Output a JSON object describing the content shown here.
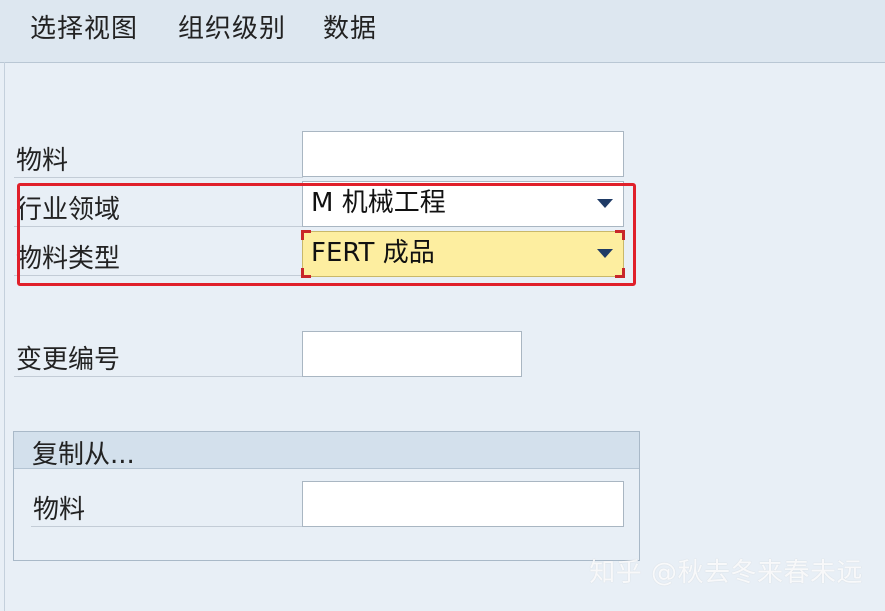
{
  "menu": {
    "items": [
      "选择视图",
      "组织级别",
      "数据"
    ]
  },
  "form": {
    "material_label": "物料",
    "material_value": "",
    "industry_label": "行业领域",
    "industry_value": "M 机械工程",
    "material_type_label": "物料类型",
    "material_type_value": "FERT 成品",
    "change_number_label": "变更编号",
    "change_number_value": ""
  },
  "copy_from": {
    "title": "复制从...",
    "material_label": "物料",
    "material_value": ""
  },
  "watermark": "知乎 @秋去冬来春未远",
  "colors": {
    "background": "#e8eff6",
    "menubar": "#dde7f0",
    "selected_field": "#fdeea0",
    "highlight": "#e0202a",
    "dropdown_arrow": "#1f3b66"
  },
  "icons": {
    "dropdown": "chevron-down-icon"
  }
}
